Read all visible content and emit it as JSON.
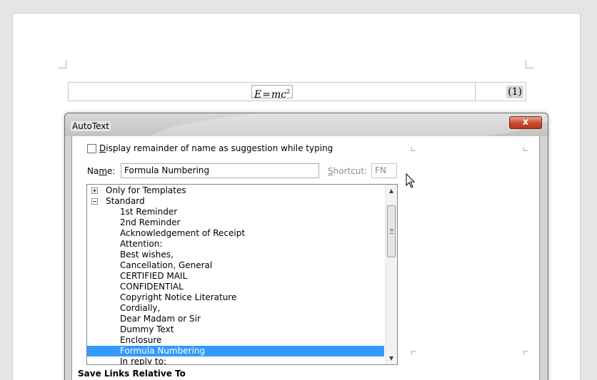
{
  "document": {
    "formula": {
      "base": "E",
      "equals": "=",
      "term": "mc",
      "exponent": "2"
    },
    "equation_number": "(1)"
  },
  "dialog": {
    "title": "AutoText",
    "close_glyph": "x",
    "suggestion_checkbox": {
      "checked": false,
      "label_accel": "D",
      "label_rest": "isplay remainder of name as suggestion while typing"
    },
    "name": {
      "label_pre": "Na",
      "label_accel": "m",
      "label_post": "e:",
      "value": "Formula Numbering"
    },
    "shortcut": {
      "label_accel": "S",
      "label_rest": "hortcut:",
      "value": "FN"
    },
    "tree": {
      "groups": [
        {
          "label": "Only for Templates",
          "expanded": false
        },
        {
          "label": "Standard",
          "expanded": true
        }
      ],
      "entries": [
        "1st Reminder",
        "2nd Reminder",
        "Acknowledgement of Receipt",
        "Attention:",
        "Best wishes,",
        "Cancellation, General",
        "CERTIFIED MAIL",
        "CONFIDENTIAL",
        "Copyright Notice Literature",
        "Cordially,",
        "Dear Madam or Sir",
        "Dummy Text",
        "Enclosure",
        "Formula Numbering",
        "In reply to:"
      ],
      "selected": "Formula Numbering"
    },
    "save_links_label": "Save Links Relative To"
  },
  "colors": {
    "selection": "#3399ff",
    "close_button": "#c94a2e"
  }
}
